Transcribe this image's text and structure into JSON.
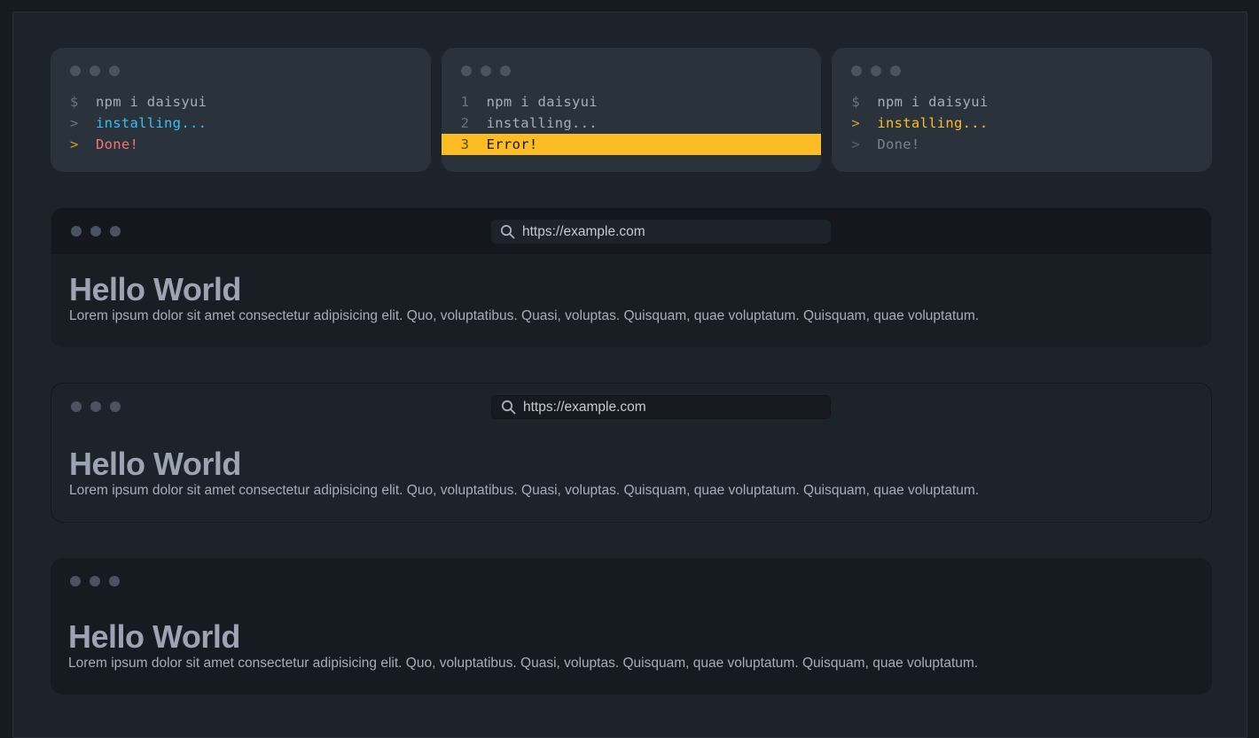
{
  "code_mockups": [
    {
      "lines": [
        {
          "prefix": "$",
          "text": "npm i daisyui"
        },
        {
          "prefix": ">",
          "text": "installing..."
        },
        {
          "prefix": ">",
          "text": "Done!"
        }
      ]
    },
    {
      "lines": [
        {
          "prefix": "1",
          "text": "npm i daisyui"
        },
        {
          "prefix": "2",
          "text": "installing..."
        },
        {
          "prefix": "3",
          "text": "Error!"
        }
      ]
    },
    {
      "lines": [
        {
          "prefix": "$",
          "text": "npm i daisyui"
        },
        {
          "prefix": ">",
          "text": "installing..."
        },
        {
          "prefix": ">",
          "text": "Done!"
        }
      ]
    }
  ],
  "browsers": [
    {
      "url": "https://example.com",
      "heading": "Hello World",
      "body": "Lorem ipsum dolor sit amet consectetur adipisicing elit. Quo, voluptatibus. Quasi, voluptas. Quisquam, quae voluptatum. Quisquam, quae voluptatum."
    },
    {
      "url": "https://example.com",
      "heading": "Hello World",
      "body": "Lorem ipsum dolor sit amet consectetur adipisicing elit. Quo, voluptatibus. Quasi, voluptas. Quisquam, quae voluptatum. Quisquam, quae voluptatum."
    },
    {
      "heading": "Hello World",
      "body": "Lorem ipsum dolor sit amet consectetur adipisicing elit. Quo, voluptatibus. Quasi, voluptas. Quisquam, quae voluptatum. Quisquam, quae voluptatum."
    }
  ],
  "icons": {
    "window_dots": "window-control-dots",
    "search": "search-icon"
  },
  "colors": {
    "info": "#3abff8",
    "error": "#f87272",
    "warning": "#fbbd23",
    "highlight": "#fbbd23"
  }
}
